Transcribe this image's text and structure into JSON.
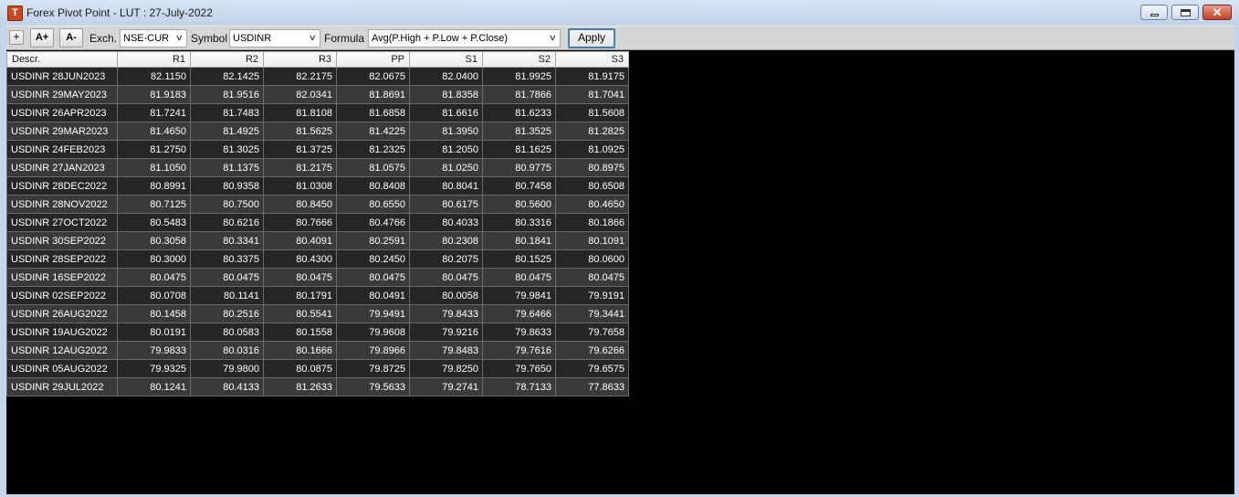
{
  "window": {
    "title": "Forex Pivot Point - LUT : 27-July-2022",
    "app_icon": "T"
  },
  "toolbar": {
    "plus_label": "+",
    "font_increase_label": "A+",
    "font_decrease_label": "A-",
    "exch_label": "Exch.",
    "exch_value": "NSE-CUR",
    "symbol_label": "Symbol",
    "symbol_value": "USDINR",
    "formula_label": "Formula",
    "formula_value": "Avg(P.High + P.Low + P.Close)",
    "apply_label": "Apply"
  },
  "table": {
    "columns": [
      "Descr.",
      "R1",
      "R2",
      "R3",
      "PP",
      "S1",
      "S2",
      "S3"
    ],
    "rows": [
      [
        "USDINR 28JUN2023",
        "82.1150",
        "82.1425",
        "82.2175",
        "82.0675",
        "82.0400",
        "81.9925",
        "81.9175"
      ],
      [
        "USDINR 29MAY2023",
        "81.9183",
        "81.9516",
        "82.0341",
        "81.8691",
        "81.8358",
        "81.7866",
        "81.7041"
      ],
      [
        "USDINR 26APR2023",
        "81.7241",
        "81.7483",
        "81.8108",
        "81.6858",
        "81.6616",
        "81.6233",
        "81.5608"
      ],
      [
        "USDINR 29MAR2023",
        "81.4650",
        "81.4925",
        "81.5625",
        "81.4225",
        "81.3950",
        "81.3525",
        "81.2825"
      ],
      [
        "USDINR 24FEB2023",
        "81.2750",
        "81.3025",
        "81.3725",
        "81.2325",
        "81.2050",
        "81.1625",
        "81.0925"
      ],
      [
        "USDINR 27JAN2023",
        "81.1050",
        "81.1375",
        "81.2175",
        "81.0575",
        "81.0250",
        "80.9775",
        "80.8975"
      ],
      [
        "USDINR 28DEC2022",
        "80.8991",
        "80.9358",
        "81.0308",
        "80.8408",
        "80.8041",
        "80.7458",
        "80.6508"
      ],
      [
        "USDINR 28NOV2022",
        "80.7125",
        "80.7500",
        "80.8450",
        "80.6550",
        "80.6175",
        "80.5600",
        "80.4650"
      ],
      [
        "USDINR 27OCT2022",
        "80.5483",
        "80.6216",
        "80.7666",
        "80.4766",
        "80.4033",
        "80.3316",
        "80.1866"
      ],
      [
        "USDINR 30SEP2022",
        "80.3058",
        "80.3341",
        "80.4091",
        "80.2591",
        "80.2308",
        "80.1841",
        "80.1091"
      ],
      [
        "USDINR 28SEP2022",
        "80.3000",
        "80.3375",
        "80.4300",
        "80.2450",
        "80.2075",
        "80.1525",
        "80.0600"
      ],
      [
        "USDINR 16SEP2022",
        "80.0475",
        "80.0475",
        "80.0475",
        "80.0475",
        "80.0475",
        "80.0475",
        "80.0475"
      ],
      [
        "USDINR 02SEP2022",
        "80.0708",
        "80.1141",
        "80.1791",
        "80.0491",
        "80.0058",
        "79.9841",
        "79.9191"
      ],
      [
        "USDINR 26AUG2022",
        "80.1458",
        "80.2516",
        "80.5541",
        "79.9491",
        "79.8433",
        "79.6466",
        "79.3441"
      ],
      [
        "USDINR 19AUG2022",
        "80.0191",
        "80.0583",
        "80.1558",
        "79.9608",
        "79.9216",
        "79.8633",
        "79.7658"
      ],
      [
        "USDINR 12AUG2022",
        "79.9833",
        "80.0316",
        "80.1666",
        "79.8966",
        "79.8483",
        "79.7616",
        "79.6266"
      ],
      [
        "USDINR 05AUG2022",
        "79.9325",
        "79.9800",
        "80.0875",
        "79.8725",
        "79.8250",
        "79.7650",
        "79.6575"
      ],
      [
        "USDINR 29JUL2022",
        "80.1241",
        "80.4133",
        "81.2633",
        "79.5633",
        "79.2741",
        "78.7133",
        "77.8633"
      ]
    ]
  }
}
